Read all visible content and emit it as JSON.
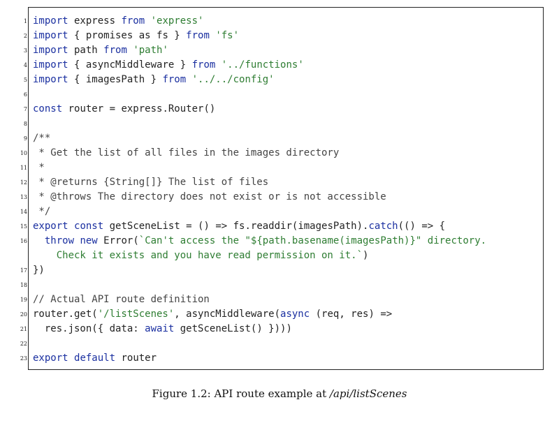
{
  "listing": {
    "lines": [
      {
        "n": "1",
        "tokens": [
          {
            "t": "import",
            "k": "kw"
          },
          {
            "t": " express ",
            "k": ""
          },
          {
            "t": "from",
            "k": "kw"
          },
          {
            "t": " ",
            "k": ""
          },
          {
            "t": "'express'",
            "k": "str"
          }
        ]
      },
      {
        "n": "2",
        "tokens": [
          {
            "t": "import",
            "k": "kw"
          },
          {
            "t": " { promises as fs } ",
            "k": ""
          },
          {
            "t": "from",
            "k": "kw"
          },
          {
            "t": " ",
            "k": ""
          },
          {
            "t": "'fs'",
            "k": "str"
          }
        ]
      },
      {
        "n": "3",
        "tokens": [
          {
            "t": "import",
            "k": "kw"
          },
          {
            "t": " path ",
            "k": ""
          },
          {
            "t": "from",
            "k": "kw"
          },
          {
            "t": " ",
            "k": ""
          },
          {
            "t": "'path'",
            "k": "str"
          }
        ]
      },
      {
        "n": "4",
        "tokens": [
          {
            "t": "import",
            "k": "kw"
          },
          {
            "t": " { asyncMiddleware } ",
            "k": ""
          },
          {
            "t": "from",
            "k": "kw"
          },
          {
            "t": " ",
            "k": ""
          },
          {
            "t": "'../functions'",
            "k": "str"
          }
        ]
      },
      {
        "n": "5",
        "tokens": [
          {
            "t": "import",
            "k": "kw"
          },
          {
            "t": " { imagesPath } ",
            "k": ""
          },
          {
            "t": "from",
            "k": "kw"
          },
          {
            "t": " ",
            "k": ""
          },
          {
            "t": "'../../config'",
            "k": "str"
          }
        ]
      },
      {
        "n": "6",
        "tokens": []
      },
      {
        "n": "7",
        "tokens": [
          {
            "t": "const",
            "k": "kw"
          },
          {
            "t": " router = express.Router()",
            "k": ""
          }
        ]
      },
      {
        "n": "8",
        "tokens": []
      },
      {
        "n": "9",
        "tokens": [
          {
            "t": "/**",
            "k": "cm"
          }
        ]
      },
      {
        "n": "10",
        "tokens": [
          {
            "t": " * Get the list of all files in the images directory",
            "k": "cm"
          }
        ]
      },
      {
        "n": "11",
        "tokens": [
          {
            "t": " *",
            "k": "cm"
          }
        ]
      },
      {
        "n": "12",
        "tokens": [
          {
            "t": " * @returns {String[]} The list of files",
            "k": "cm"
          }
        ]
      },
      {
        "n": "13",
        "tokens": [
          {
            "t": " * @throws The directory does not exist or is not accessible",
            "k": "cm"
          }
        ]
      },
      {
        "n": "14",
        "tokens": [
          {
            "t": " */",
            "k": "cm"
          }
        ]
      },
      {
        "n": "15",
        "tokens": [
          {
            "t": "export",
            "k": "kw"
          },
          {
            "t": " ",
            "k": ""
          },
          {
            "t": "const",
            "k": "kw"
          },
          {
            "t": " getSceneList = () => fs.readdir(imagesPath).",
            "k": ""
          },
          {
            "t": "catch",
            "k": "kw"
          },
          {
            "t": "(() => {",
            "k": ""
          }
        ]
      },
      {
        "n": "16",
        "tokens": [
          {
            "t": "  ",
            "k": ""
          },
          {
            "t": "throw",
            "k": "kw"
          },
          {
            "t": " ",
            "k": ""
          },
          {
            "t": "new",
            "k": "kw"
          },
          {
            "t": " Error(",
            "k": ""
          },
          {
            "t": "`Can't access the \"${path.basename(imagesPath)}\" directory.",
            "k": "str"
          }
        ]
      },
      {
        "n": "",
        "tokens": [
          {
            "t": "    Check it exists and you have read permission on it.`",
            "k": "str"
          },
          {
            "t": ")",
            "k": ""
          }
        ]
      },
      {
        "n": "17",
        "tokens": [
          {
            "t": "})",
            "k": ""
          }
        ]
      },
      {
        "n": "18",
        "tokens": []
      },
      {
        "n": "19",
        "tokens": [
          {
            "t": "// Actual API route definition",
            "k": "cm"
          }
        ]
      },
      {
        "n": "20",
        "tokens": [
          {
            "t": "router.get(",
            "k": ""
          },
          {
            "t": "'/listScenes'",
            "k": "str"
          },
          {
            "t": ", asyncMiddleware(",
            "k": ""
          },
          {
            "t": "async",
            "k": "kw"
          },
          {
            "t": " (req, res) =>",
            "k": ""
          }
        ]
      },
      {
        "n": "21",
        "tokens": [
          {
            "t": "  res.json({ data: ",
            "k": ""
          },
          {
            "t": "await",
            "k": "kw"
          },
          {
            "t": " getSceneList() })))",
            "k": ""
          }
        ]
      },
      {
        "n": "22",
        "tokens": []
      },
      {
        "n": "23",
        "tokens": [
          {
            "t": "export",
            "k": "kw"
          },
          {
            "t": " ",
            "k": ""
          },
          {
            "t": "default",
            "k": "kw"
          },
          {
            "t": " router",
            "k": ""
          }
        ]
      }
    ]
  },
  "caption": {
    "prefix": "Figure 1.2: API route example at ",
    "path": "/api/listScenes"
  }
}
